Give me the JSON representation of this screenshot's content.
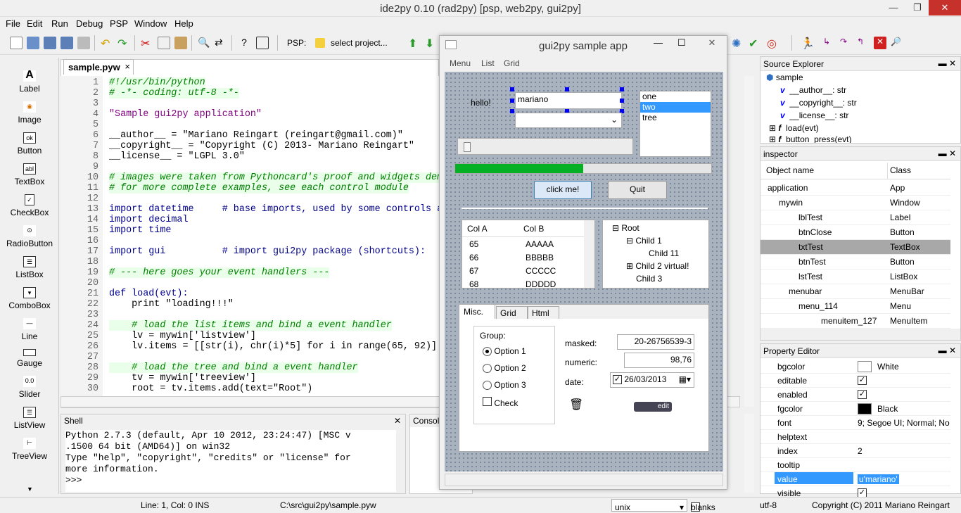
{
  "window": {
    "title": "ide2py 0.10 (rad2py) [psp, web2py, gui2py]",
    "minimize": "—",
    "restore": "❐",
    "close": "✕"
  },
  "menu": [
    "File",
    "Edit",
    "Run",
    "Debug",
    "PSP",
    "Window",
    "Help"
  ],
  "toolbar": {
    "psp_label": "PSP:",
    "psp_select": "select project..."
  },
  "palette": [
    {
      "label": "Label",
      "icon": "A"
    },
    {
      "label": "Image",
      "icon": "◉"
    },
    {
      "label": "Button",
      "icon": "ok"
    },
    {
      "label": "TextBox",
      "icon": "abl"
    },
    {
      "label": "CheckBox",
      "icon": "✓"
    },
    {
      "label": "RadioButton",
      "icon": "⊙"
    },
    {
      "label": "ListBox",
      "icon": "☰"
    },
    {
      "label": "ComboBox",
      "icon": "▾"
    },
    {
      "label": "Line",
      "icon": "—"
    },
    {
      "label": "Gauge",
      "icon": "▭"
    },
    {
      "label": "Slider",
      "icon": "0.0"
    },
    {
      "label": "ListView",
      "icon": "☰"
    },
    {
      "label": "TreeView",
      "icon": "⊢"
    }
  ],
  "editor": {
    "tab": "sample.pyw",
    "tab_close": "×",
    "lines": [
      {
        "n": "1",
        "t": "#!/usr/bin/python",
        "c": "cm"
      },
      {
        "n": "2",
        "t": "# -*- coding: utf-8 -*-",
        "c": "cm"
      },
      {
        "n": "3",
        "t": "",
        "c": ""
      },
      {
        "n": "4",
        "t": "\"Sample gui2py application\"",
        "c": "st"
      },
      {
        "n": "5",
        "t": "",
        "c": ""
      },
      {
        "n": "6",
        "t": "__author__ = \"Mariano Reingart (reingart@gmail.com)\"",
        "c": ""
      },
      {
        "n": "7",
        "t": "__copyright__ = \"Copyright (C) 2013- Mariano Reingart\"",
        "c": ""
      },
      {
        "n": "8",
        "t": "__license__ = \"LGPL 3.0\"",
        "c": ""
      },
      {
        "n": "9",
        "t": "",
        "c": ""
      },
      {
        "n": "10",
        "t": "# images were taken from Pythoncard's proof and widgets dem",
        "c": "cm"
      },
      {
        "n": "11",
        "t": "# for more complete examples, see each control module",
        "c": "cm"
      },
      {
        "n": "12",
        "t": "",
        "c": ""
      },
      {
        "n": "13",
        "t": "import datetime     # base imports, used by some controls a",
        "c": "kw"
      },
      {
        "n": "14",
        "t": "import decimal",
        "c": "kw"
      },
      {
        "n": "15",
        "t": "import time",
        "c": "kw"
      },
      {
        "n": "16",
        "t": "",
        "c": ""
      },
      {
        "n": "17",
        "t": "import gui          # import gui2py package (shortcuts):",
        "c": "kw"
      },
      {
        "n": "18",
        "t": "",
        "c": ""
      },
      {
        "n": "19",
        "t": "# --- here goes your event handlers ---",
        "c": "cm"
      },
      {
        "n": "20",
        "t": "",
        "c": ""
      },
      {
        "n": "21",
        "t": "def load(evt):",
        "c": "kw"
      },
      {
        "n": "22",
        "t": "    print \"loading!!!\"",
        "c": ""
      },
      {
        "n": "23",
        "t": "",
        "c": ""
      },
      {
        "n": "24",
        "t": "    # load the list items and bind a event handler",
        "c": "cm"
      },
      {
        "n": "25",
        "t": "    lv = mywin['listview']",
        "c": ""
      },
      {
        "n": "26",
        "t": "    lv.items = [[str(i), chr(i)*5] for i in range(65, 92)]",
        "c": ""
      },
      {
        "n": "27",
        "t": "",
        "c": ""
      },
      {
        "n": "28",
        "t": "    # load the tree and bind a event handler",
        "c": "cm"
      },
      {
        "n": "29",
        "t": "    tv = mywin['treeview']",
        "c": ""
      },
      {
        "n": "30",
        "t": "    root = tv.items.add(text=\"Root\")",
        "c": ""
      }
    ]
  },
  "shell": {
    "title": "Shell",
    "close": "✕",
    "text": "Python 2.7.3 (default, Apr 10 2012, 23:24:47) [MSC v\n.1500 64 bit (AMD64)] on win32\nType \"help\", \"copyright\", \"credits\" or \"license\" for\nmore information.\n>>>"
  },
  "console": {
    "title": "Console"
  },
  "app": {
    "title": "gui2py sample app",
    "menu": [
      "Menu",
      "List",
      "Grid"
    ],
    "hello": "hello!",
    "textbox": "mariano",
    "listbox": [
      "one",
      "two",
      "tree"
    ],
    "listbox_selected": 1,
    "gauge_value": 0.5,
    "click_btn": "click me!",
    "quit_btn": "Quit",
    "listview": {
      "headers": [
        "Col A",
        "Col B"
      ],
      "rows": [
        [
          "65",
          "AAAAA"
        ],
        [
          "66",
          "BBBBB"
        ],
        [
          "67",
          "CCCCC"
        ],
        [
          "68",
          "DDDDD"
        ]
      ]
    },
    "tree": [
      "Root",
      "Child 1",
      "Child 11",
      "Child 2 virtual!",
      "Child 3"
    ],
    "tabs": [
      "Misc.",
      "Grid",
      "Html"
    ],
    "group": "Group:",
    "radios": [
      "Option 1",
      "Option 2",
      "Option 3"
    ],
    "check": "Check",
    "masked_label": "masked:",
    "masked_value": "20-26756539-3",
    "numeric_label": "numeric:",
    "numeric_value": "98,76",
    "date_label": "date:",
    "date_value": "26/03/2013",
    "edit_btn": "edit"
  },
  "source_explorer": {
    "title": "Source Explorer",
    "items": [
      "sample",
      "__author__: str",
      "__copyright__: str",
      "__license__: str",
      "load(evt)",
      "button_press(evt)"
    ]
  },
  "inspector": {
    "title": "inspector",
    "col1": "Object name",
    "col2": "Class",
    "rows": [
      [
        "application",
        "App"
      ],
      [
        "mywin",
        "Window"
      ],
      [
        "lblTest",
        "Label"
      ],
      [
        "btnClose",
        "Button"
      ],
      [
        "txtTest",
        "TextBox"
      ],
      [
        "btnTest",
        "Button"
      ],
      [
        "lstTest",
        "ListBox"
      ],
      [
        "menubar",
        "MenuBar"
      ],
      [
        "menu_114",
        "Menu"
      ],
      [
        "menuitem_127",
        "MenuItem"
      ]
    ]
  },
  "property_editor": {
    "title": "Property Editor",
    "rows": [
      [
        "bgcolor",
        "White"
      ],
      [
        "editable",
        "✓"
      ],
      [
        "enabled",
        "✓"
      ],
      [
        "fgcolor",
        "Black"
      ],
      [
        "font",
        "9; Segoe UI; Normal; No"
      ],
      [
        "helptext",
        ""
      ],
      [
        "index",
        "2"
      ],
      [
        "tooltip",
        ""
      ],
      [
        "value",
        "u'mariano'"
      ],
      [
        "visible",
        "✓"
      ]
    ]
  },
  "status": {
    "pos": "Line: 1, Col: 0  INS",
    "path": "C:\\src\\gui2py\\sample.pyw",
    "eol": "unix",
    "blanks": "blanks",
    "enc": "utf-8",
    "copyright": "Copyright (C) 2011 Mariano Reingart"
  }
}
